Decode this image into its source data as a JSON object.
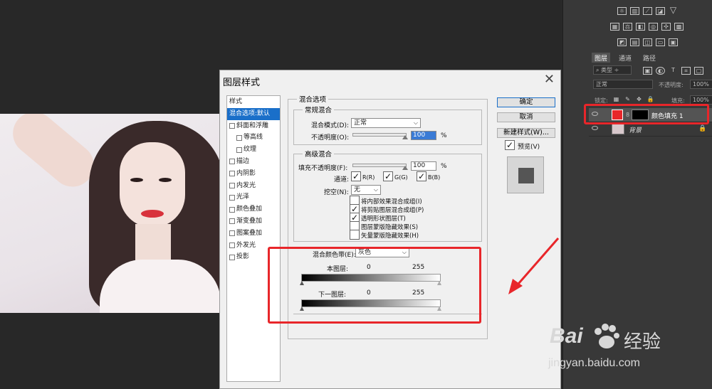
{
  "dialog": {
    "title": "图层样式",
    "close_icon": "close-icon",
    "styles_header": "样式",
    "style_items": [
      {
        "label": "混合选项:默认",
        "selected": true,
        "checkbox": false,
        "indent": false
      },
      {
        "label": "斜面和浮雕",
        "selected": false,
        "checkbox": true,
        "indent": false
      },
      {
        "label": "等高线",
        "selected": false,
        "checkbox": true,
        "indent": true
      },
      {
        "label": "纹理",
        "selected": false,
        "checkbox": true,
        "indent": true
      },
      {
        "label": "描边",
        "selected": false,
        "checkbox": true,
        "indent": false
      },
      {
        "label": "内阴影",
        "selected": false,
        "checkbox": true,
        "indent": false
      },
      {
        "label": "内发光",
        "selected": false,
        "checkbox": true,
        "indent": false
      },
      {
        "label": "光泽",
        "selected": false,
        "checkbox": true,
        "indent": false
      },
      {
        "label": "颜色叠加",
        "selected": false,
        "checkbox": true,
        "indent": false
      },
      {
        "label": "渐变叠加",
        "selected": false,
        "checkbox": true,
        "indent": false
      },
      {
        "label": "图案叠加",
        "selected": false,
        "checkbox": true,
        "indent": false
      },
      {
        "label": "外发光",
        "selected": false,
        "checkbox": true,
        "indent": false
      },
      {
        "label": "投影",
        "selected": false,
        "checkbox": true,
        "indent": false
      }
    ],
    "blend_options_title": "混合选项",
    "general_title": "常规混合",
    "blend_mode_label": "混合模式(D):",
    "blend_mode_value": "正常",
    "opacity_label": "不透明度(O):",
    "opacity_value": "100",
    "percent": "%",
    "advanced_title": "高级混合",
    "fill_opacity_label": "填充不透明度(F):",
    "fill_opacity_value": "100",
    "channels_label": "通道:",
    "channel_r": "R(R)",
    "channel_g": "G(G)",
    "channel_b": "B(B)",
    "knockout_label": "挖空(N):",
    "knockout_value": "无",
    "options": [
      {
        "label": "将内部效果混合成组(I)",
        "checked": false
      },
      {
        "label": "将剪贴图层混合成组(P)",
        "checked": true
      },
      {
        "label": "透明形状图层(T)",
        "checked": true
      },
      {
        "label": "图层蒙版隐藏效果(S)",
        "checked": false
      },
      {
        "label": "矢量蒙版隐藏效果(H)",
        "checked": false
      }
    ],
    "blend_if_label": "混合颜色带(E):",
    "blend_if_value": "灰色",
    "this_layer_label": "本图层:",
    "this_layer_min": "0",
    "this_layer_max": "255",
    "underlying_label": "下一图层:",
    "underlying_min": "0",
    "underlying_max": "255",
    "ok_label": "确定",
    "cancel_label": "取消",
    "new_style_label": "新建样式(W)...",
    "preview_label": "预览(V)",
    "preview_checked": true
  },
  "layers_panel": {
    "tabs": [
      "图层",
      "通道",
      "路径"
    ],
    "filter_label": "类型",
    "blend_mode": "正常",
    "opacity_label": "不透明度:",
    "opacity_value": "100%",
    "lock_label": "锁定:",
    "fill_label": "填充:",
    "fill_value": "100%",
    "layers": [
      {
        "name": "颜色填充 1",
        "selected": true,
        "thumb_color": "#e8262a"
      },
      {
        "name": "背景",
        "selected": false,
        "thumb_color": "#d8c8cc"
      }
    ]
  },
  "colors": {
    "annotation_red": "#e8262a",
    "selection_blue": "#1a6fc9",
    "watermark": "#d8d8d8"
  },
  "watermark": {
    "brand": "Bai",
    "brand_suffix": "经验",
    "url": "jingyan.baidu.com"
  }
}
